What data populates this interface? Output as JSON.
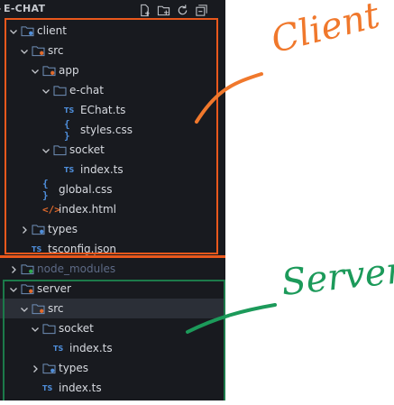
{
  "explorer": {
    "title": "E-CHAT",
    "actions": [
      {
        "name": "new-file-icon"
      },
      {
        "name": "new-folder-icon"
      },
      {
        "name": "refresh-icon"
      },
      {
        "name": "collapse-all-icon"
      }
    ],
    "rows": [
      {
        "label": "client",
        "kind": "folder",
        "icon": "folder-client",
        "expanded": true
      },
      {
        "label": "src",
        "kind": "folder",
        "icon": "folder-src",
        "expanded": true
      },
      {
        "label": "app",
        "kind": "folder",
        "icon": "folder-app",
        "expanded": true
      },
      {
        "label": "e-chat",
        "kind": "folder",
        "icon": "folder-plain",
        "expanded": true
      },
      {
        "label": "EChat.ts",
        "kind": "file",
        "icon": "ts"
      },
      {
        "label": "styles.css",
        "kind": "file",
        "icon": "css"
      },
      {
        "label": "socket",
        "kind": "folder",
        "icon": "folder-plain",
        "expanded": true
      },
      {
        "label": "index.ts",
        "kind": "file",
        "icon": "ts"
      },
      {
        "label": "global.css",
        "kind": "file",
        "icon": "css"
      },
      {
        "label": "index.html",
        "kind": "file",
        "icon": "html"
      },
      {
        "label": "types",
        "kind": "folder",
        "icon": "folder-types",
        "expanded": false
      },
      {
        "label": "tsconfig.json",
        "kind": "file",
        "icon": "ts"
      },
      {
        "label": "node_modules",
        "kind": "folder",
        "icon": "folder-node",
        "expanded": false,
        "dim": true
      },
      {
        "label": "server",
        "kind": "folder",
        "icon": "folder-server",
        "expanded": true
      },
      {
        "label": "src",
        "kind": "folder",
        "icon": "folder-src",
        "expanded": true,
        "selected": true
      },
      {
        "label": "socket",
        "kind": "folder",
        "icon": "folder-plain",
        "expanded": true
      },
      {
        "label": "index.ts",
        "kind": "file",
        "icon": "ts"
      },
      {
        "label": "types",
        "kind": "folder",
        "icon": "folder-types",
        "expanded": false
      },
      {
        "label": "index.ts",
        "kind": "file",
        "icon": "ts"
      }
    ]
  },
  "file_icon_text": {
    "ts": "TS",
    "css": "{ }",
    "html": "</>"
  },
  "annotations": {
    "client": {
      "text": "Client",
      "color": "#f0782c"
    },
    "server": {
      "text": "Server",
      "color": "#1c9a5a"
    }
  },
  "colors": {
    "client_box": "#e9581c",
    "server_box": "#1c7a4a",
    "sidebar_bg": "#181a1f",
    "selected_row": "#2b2f37"
  }
}
